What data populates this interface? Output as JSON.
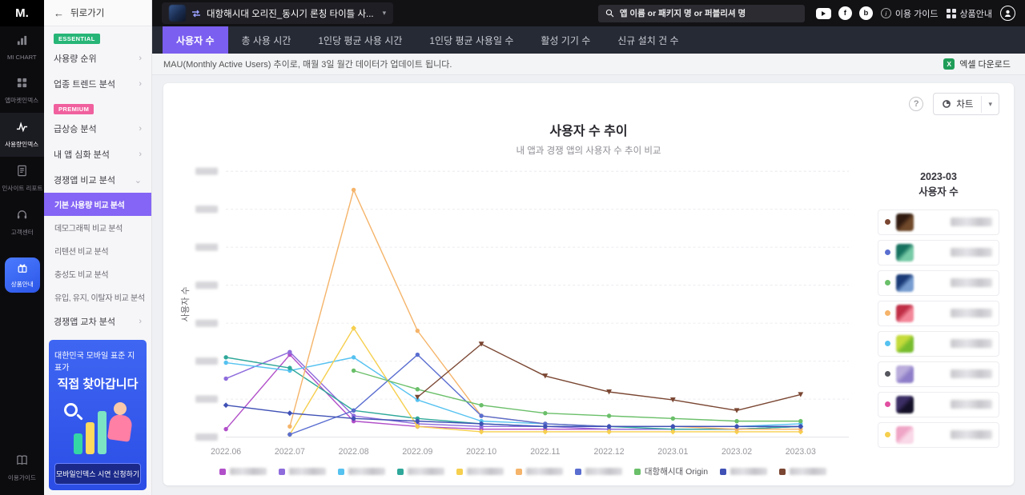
{
  "brand": {
    "logo_text": "M."
  },
  "icons": {
    "back_arrow": "←",
    "chevron_right": "›",
    "chevron_down": "⌄",
    "caret_down": "▾",
    "help_glyph": "?",
    "excel_glyph": "X"
  },
  "rail": {
    "items": [
      {
        "label": "MI CHART"
      },
      {
        "label": "앱마켓인덱스"
      },
      {
        "label": "사용량인덱스",
        "active": true
      },
      {
        "label": "인사이트 리포트"
      },
      {
        "label": "고객센터"
      },
      {
        "label": "상품안내",
        "highlight": true
      }
    ],
    "bottom_label": "이용가이드"
  },
  "sidebar": {
    "back_label": "뒤로가기",
    "essential_badge": "ESSENTIAL",
    "essential_items": [
      "사용량 순위",
      "업종 트렌드 분석"
    ],
    "premium_badge": "PREMIUM",
    "premium_items": [
      "급상승 분석",
      "내 앱 심화 분석",
      "경쟁앱 비교 분석"
    ],
    "competitor_children": [
      "기본 사용량 비교 분석",
      "데모그래픽 비교 분석",
      "리텐션 비교 분석",
      "충성도 비교 분석",
      "유입, 유지, 이탈자 비교 분석"
    ],
    "active_child_index": 0,
    "last_item": "경쟁앱 교차 분석",
    "banner": {
      "line1": "대한민국 모바일 표준 지표가",
      "line2": "직접 찾아갑니다",
      "button_label": "모바일인덱스 시연 신청하기"
    }
  },
  "header": {
    "app_selector_label": "대항해시대 오리진_동시기 론칭 타이틀 사...",
    "search_placeholder": "앱 이름 or 패키지 명 or 퍼블리셔 명",
    "guide_label": "이용 가이드",
    "product_label": "상품안내",
    "facebook_glyph": "f",
    "blog_glyph": "b"
  },
  "tabs": {
    "active_index": 0,
    "items": [
      "사용자 수",
      "총 사용 시간",
      "1인당 평균 사용 시간",
      "1인당 평균 사용일 수",
      "활성 기기 수",
      "신규 설치 건 수"
    ]
  },
  "info_bar": {
    "message": "MAU(Monthly Active Users) 추이로, 매월 3일 월간 데이터가 업데이트 됩니다.",
    "excel_label": "엑셀 다운로드"
  },
  "controls": {
    "chart_button_label": "차트"
  },
  "chart_data": {
    "type": "line",
    "title": "사용자 수 추이",
    "subtitle": "내 앱과 경쟁 앱의 사용자 수 추이 비교",
    "ylabel": "사용자 수",
    "x_categories": [
      "2022.06",
      "2022.07",
      "2022.08",
      "2022.09",
      "2022.10",
      "2022.11",
      "2022.12",
      "2023.01",
      "2023.02",
      "2023.03"
    ],
    "ylim": [
      0,
      100
    ],
    "values_unit": "relative percent of axis height (y tick labels blurred in source)",
    "grid": "horizontal-dashed",
    "legend_position": "bottom",
    "series": [
      {
        "name": "",
        "name_redacted": true,
        "color": "#b14fc9",
        "marker": "circle",
        "values": [
          3,
          31,
          6,
          4,
          3,
          3,
          3,
          3,
          3,
          4
        ]
      },
      {
        "name": "",
        "name_redacted": true,
        "color": "#8e6cdc",
        "marker": "circle",
        "values": [
          22,
          32,
          8,
          5,
          4,
          4,
          3,
          3,
          3,
          4
        ]
      },
      {
        "name": "",
        "name_redacted": true,
        "color": "#56c2f0",
        "marker": "circle",
        "values": [
          28,
          25,
          30,
          14,
          6,
          5,
          4,
          4,
          4,
          5
        ]
      },
      {
        "name": "",
        "name_redacted": true,
        "color": "#2fa89a",
        "marker": "circle",
        "values": [
          30,
          26,
          10,
          7,
          5,
          4,
          4,
          3,
          3,
          4
        ]
      },
      {
        "name": "",
        "name_redacted": true,
        "color": "#f6cf4e",
        "marker": "diamond",
        "values": [
          null,
          1,
          41,
          4,
          2,
          2,
          2,
          2,
          2,
          2
        ]
      },
      {
        "name": "",
        "name_redacted": true,
        "color": "#f5b46a",
        "marker": "circle",
        "values": [
          null,
          4,
          93,
          40,
          8,
          5,
          4,
          4,
          3,
          3
        ]
      },
      {
        "name": "",
        "name_redacted": true,
        "color": "#5a6ed0",
        "marker": "circle",
        "values": [
          null,
          1,
          10,
          31,
          8,
          5,
          4,
          4,
          4,
          4
        ]
      },
      {
        "name": "대항해시대 Origin",
        "color": "#6abf69",
        "marker": "circle",
        "values": [
          null,
          null,
          25,
          18,
          12,
          9,
          8,
          7,
          6,
          6
        ]
      },
      {
        "name": "",
        "name_redacted": true,
        "color": "#3f51b5",
        "marker": "diamond",
        "values": [
          12,
          9,
          7,
          6,
          5,
          4,
          4,
          4,
          4,
          4
        ]
      },
      {
        "name": "",
        "name_redacted": true,
        "color": "#7a4632",
        "marker": "triangle-down",
        "values": [
          null,
          null,
          null,
          15,
          35,
          23,
          17,
          14,
          10,
          16
        ]
      }
    ]
  },
  "right_panel": {
    "title_line1": "2023-03",
    "title_line2": "사용자 수",
    "rows": [
      {
        "dot_color": "#7a4632",
        "icon_colors": [
          "#2e1b12",
          "#6b4a2f"
        ],
        "value": "redacted"
      },
      {
        "dot_color": "#5a6ed0",
        "icon_colors": [
          "#1f6e5e",
          "#7fc7a8"
        ],
        "value": "redacted"
      },
      {
        "dot_color": "#6abf69",
        "icon_colors": [
          "#1d3a6e",
          "#7b9cc9"
        ],
        "value": "redacted"
      },
      {
        "dot_color": "#f5b46a",
        "icon_colors": [
          "#b03246",
          "#e88a9a"
        ],
        "value": "redacted"
      },
      {
        "dot_color": "#56c2f0",
        "icon_colors": [
          "#c6d94e",
          "#7db93d"
        ],
        "value": "redacted"
      },
      {
        "dot_color": "#55565e",
        "icon_colors": [
          "#b9aed6",
          "#8d7fc0"
        ],
        "value": "redacted"
      },
      {
        "dot_color": "#e14fa0",
        "icon_colors": [
          "#3a2f5e",
          "#141024"
        ],
        "value": "redacted"
      },
      {
        "dot_color": "#f6cf4e",
        "icon_colors": [
          "#e8a7c3",
          "#f6d9e6"
        ],
        "value": "redacted"
      }
    ]
  }
}
